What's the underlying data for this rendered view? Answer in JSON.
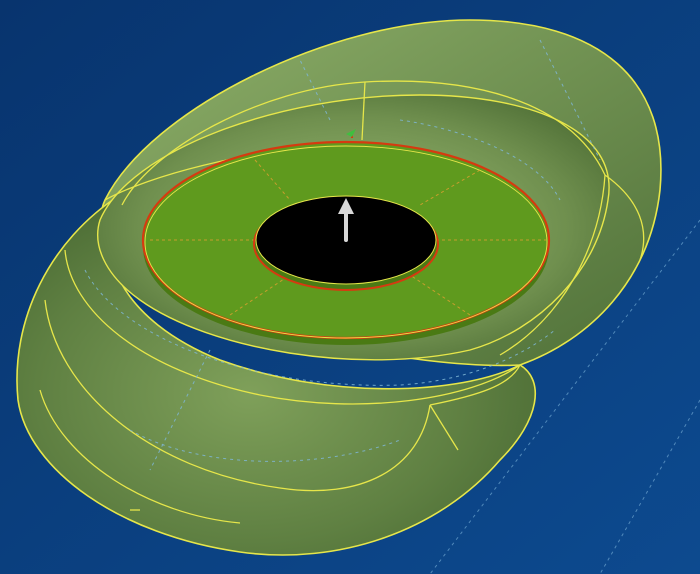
{
  "viewport": {
    "background": "#0a3a78",
    "background_gradient_end": "#0d4a8f",
    "surface_color": "#6f8f4e",
    "edge_color": "#e6e64a",
    "selected_face_color": "#5f9a1e",
    "selected_edge_color": "#d63a10",
    "hole_color": "#000000",
    "construction_line_color": "#7fb7d6",
    "normal_arrow_icon": "up-arrow-icon",
    "normal_arrow_color": "#d8d8d8",
    "triad_marker_icon": "axis-triad-icon",
    "triad_marker_color": "#3fbf3f"
  }
}
